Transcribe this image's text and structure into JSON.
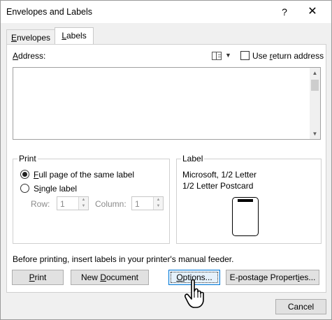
{
  "window": {
    "title": "Envelopes and Labels",
    "help_label": "?",
    "close_label": "✕"
  },
  "tabs": [
    {
      "label_prefix": "",
      "label_underline": "E",
      "label_rest": "nvelopes",
      "active": false
    },
    {
      "label_prefix": "",
      "label_underline": "L",
      "label_rest": "abels",
      "active": true
    }
  ],
  "address": {
    "label_underline": "A",
    "label_rest": "ddress:",
    "value": "",
    "use_return_label_prefix": "Use ",
    "use_return_label_underline": "r",
    "use_return_label_rest": "eturn address",
    "use_return_checked": false,
    "address_book_icon": "address-book-icon"
  },
  "print_group": {
    "title": "Print",
    "full_page_underline": "F",
    "full_page_rest": "ull page of the same label",
    "single_prefix": "S",
    "single_underline": "i",
    "single_rest": "ngle label",
    "selected": "full_page",
    "row_label": "Row:",
    "row_value": "1",
    "column_label": "Column:",
    "column_value": "1"
  },
  "label_group": {
    "title": "Label",
    "line1": "Microsoft, 1/2 Letter",
    "line2": "1/2 Letter Postcard"
  },
  "instruction": "Before printing, insert labels in your printer's manual feeder.",
  "buttons": {
    "print_underline": "P",
    "print_rest": "rint",
    "new_doc_prefix": "New ",
    "new_doc_underline": "D",
    "new_doc_rest": "ocument",
    "options_underline": "O",
    "options_rest": "ptions...",
    "epostage_prefix": "E-postage Propert",
    "epostage_underline": "i",
    "epostage_rest": "es...",
    "cancel": "Cancel"
  }
}
